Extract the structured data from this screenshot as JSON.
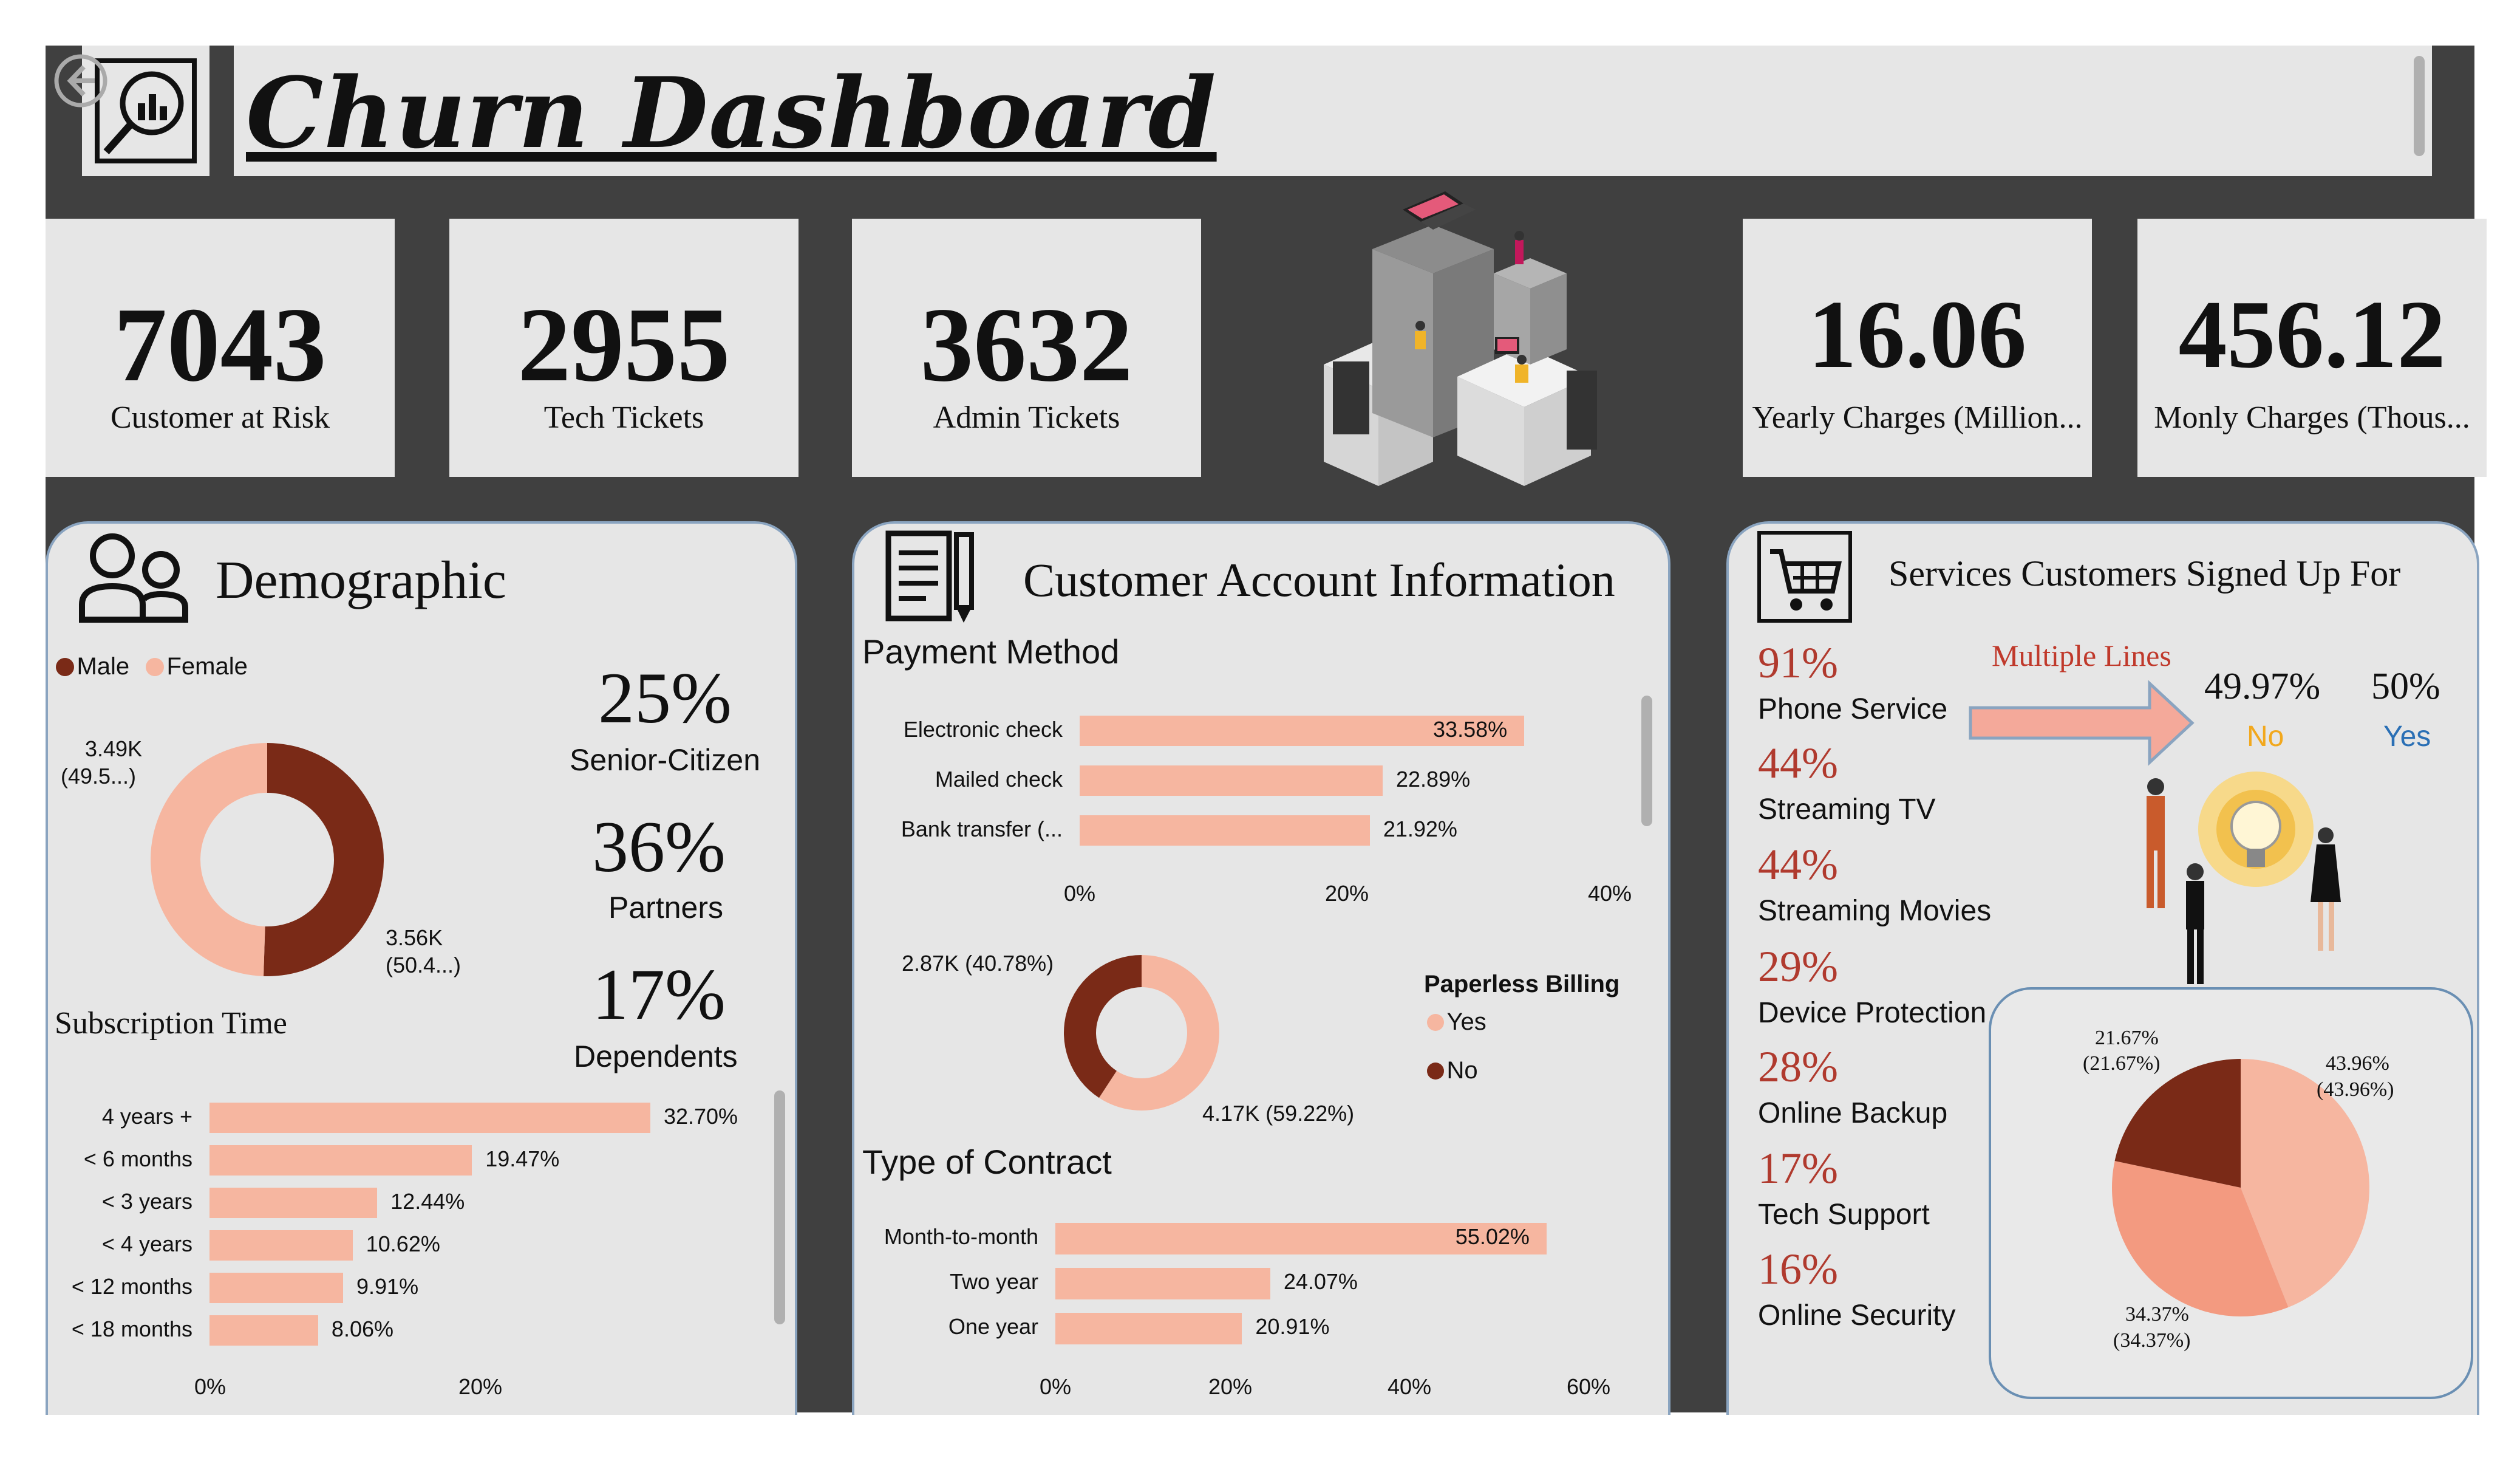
{
  "header": {
    "title": "Churn Dashboard"
  },
  "kpis": [
    {
      "value": "7043",
      "label": "Customer at Risk"
    },
    {
      "value": "2955",
      "label": "Tech Tickets"
    },
    {
      "value": "3632",
      "label": "Admin Tickets"
    },
    {
      "value": "16.06",
      "label": "Yearly Charges (Million..."
    },
    {
      "value": "456.12",
      "label": "Monly Charges (Thous..."
    }
  ],
  "demographic": {
    "title": "Demographic",
    "legend": {
      "male": "Male",
      "female": "Female"
    },
    "donut_female_label": "3.49K",
    "donut_female_label2": "(49.5...)",
    "donut_male_label": "3.56K",
    "donut_male_label2": "(50.4...)",
    "stats": [
      {
        "value": "25%",
        "label": "Senior-Citizen"
      },
      {
        "value": "36%",
        "label": "Partners"
      },
      {
        "value": "17%",
        "label": "Dependents"
      }
    ],
    "subscription_title": "Subscription Time",
    "axis": [
      "0%",
      "20%"
    ]
  },
  "account": {
    "title": "Customer Account Information",
    "payment_title": "Payment Method",
    "payment_axis": [
      "0%",
      "20%",
      "40%"
    ],
    "paperless_title": "Paperless Billing",
    "paperless_yes": "Yes",
    "paperless_no": "No",
    "paperless_no_label": "2.87K (40.78%)",
    "paperless_yes_label": "4.17K (59.22%)",
    "contract_title": "Type of Contract",
    "contract_axis": [
      "0%",
      "20%",
      "40%",
      "60%"
    ]
  },
  "services": {
    "title": "Services Customers Signed Up For",
    "items": [
      {
        "pct": "91%",
        "label": "Phone Service"
      },
      {
        "pct": "44%",
        "label": "Streaming TV"
      },
      {
        "pct": "44%",
        "label": "Streaming Movies"
      },
      {
        "pct": "29%",
        "label": "Device Protection"
      },
      {
        "pct": "28%",
        "label": "Online Backup"
      },
      {
        "pct": "17%",
        "label": "Tech Support"
      },
      {
        "pct": "16%",
        "label": "Online Security"
      }
    ],
    "multiple_lines_title": "Multiple Lines",
    "no_pct": "49.97%",
    "no_label": "No",
    "yes_pct": "50%",
    "yes_label": "Yes",
    "pie_labels": {
      "a1": "21.67%",
      "a2": "(21.67%)",
      "b1": "43.96%",
      "b2": "(43.96%)",
      "c1": "34.37%",
      "c2": "(34.37%)"
    }
  },
  "chart_data": [
    {
      "type": "pie",
      "title": "",
      "subtitle": "donut",
      "categories": [
        "Male",
        "Female"
      ],
      "values": [
        3560,
        3490
      ],
      "labels": [
        "3.56K (50.4...)",
        "3.49K (49.5...)"
      ],
      "colors": [
        "#7a2a17",
        "#f6b6a0"
      ]
    },
    {
      "type": "bar",
      "title": "Subscription Time",
      "orientation": "horizontal",
      "categories": [
        "4 years +",
        "< 6 months",
        "< 3 years",
        "< 4 years",
        "< 12 months",
        "< 18 months"
      ],
      "values": [
        32.7,
        19.47,
        12.44,
        10.62,
        9.91,
        8.06
      ],
      "labels": [
        "32.70%",
        "19.47%",
        "12.44%",
        "10.62%",
        "9.91%",
        "8.06%"
      ],
      "xlim": [
        0,
        40
      ]
    },
    {
      "type": "bar",
      "title": "Payment Method",
      "orientation": "horizontal",
      "categories": [
        "Electronic check",
        "Mailed check",
        "Bank transfer (..."
      ],
      "values": [
        33.58,
        22.89,
        21.92
      ],
      "labels": [
        "33.58%",
        "22.89%",
        "21.92%"
      ],
      "xlim": [
        0,
        40
      ]
    },
    {
      "type": "pie",
      "title": "Paperless Billing",
      "subtitle": "donut",
      "categories": [
        "Yes",
        "No"
      ],
      "values": [
        59.22,
        40.78
      ],
      "colors": [
        "#f6b6a0",
        "#7a2a17"
      ]
    },
    {
      "type": "bar",
      "title": "Type of Contract",
      "orientation": "horizontal",
      "categories": [
        "Month-to-month",
        "Two year",
        "One year"
      ],
      "values": [
        55.02,
        24.07,
        20.91
      ],
      "labels": [
        "55.02%",
        "24.07%",
        "20.91%"
      ],
      "xlim": [
        0,
        60
      ]
    },
    {
      "type": "pie",
      "title": "",
      "categories": [
        "",
        "",
        ""
      ],
      "values": [
        43.96,
        34.37,
        21.67
      ],
      "colors": [
        "#f6b6a0",
        "#f39a80",
        "#7a2a17"
      ]
    }
  ]
}
